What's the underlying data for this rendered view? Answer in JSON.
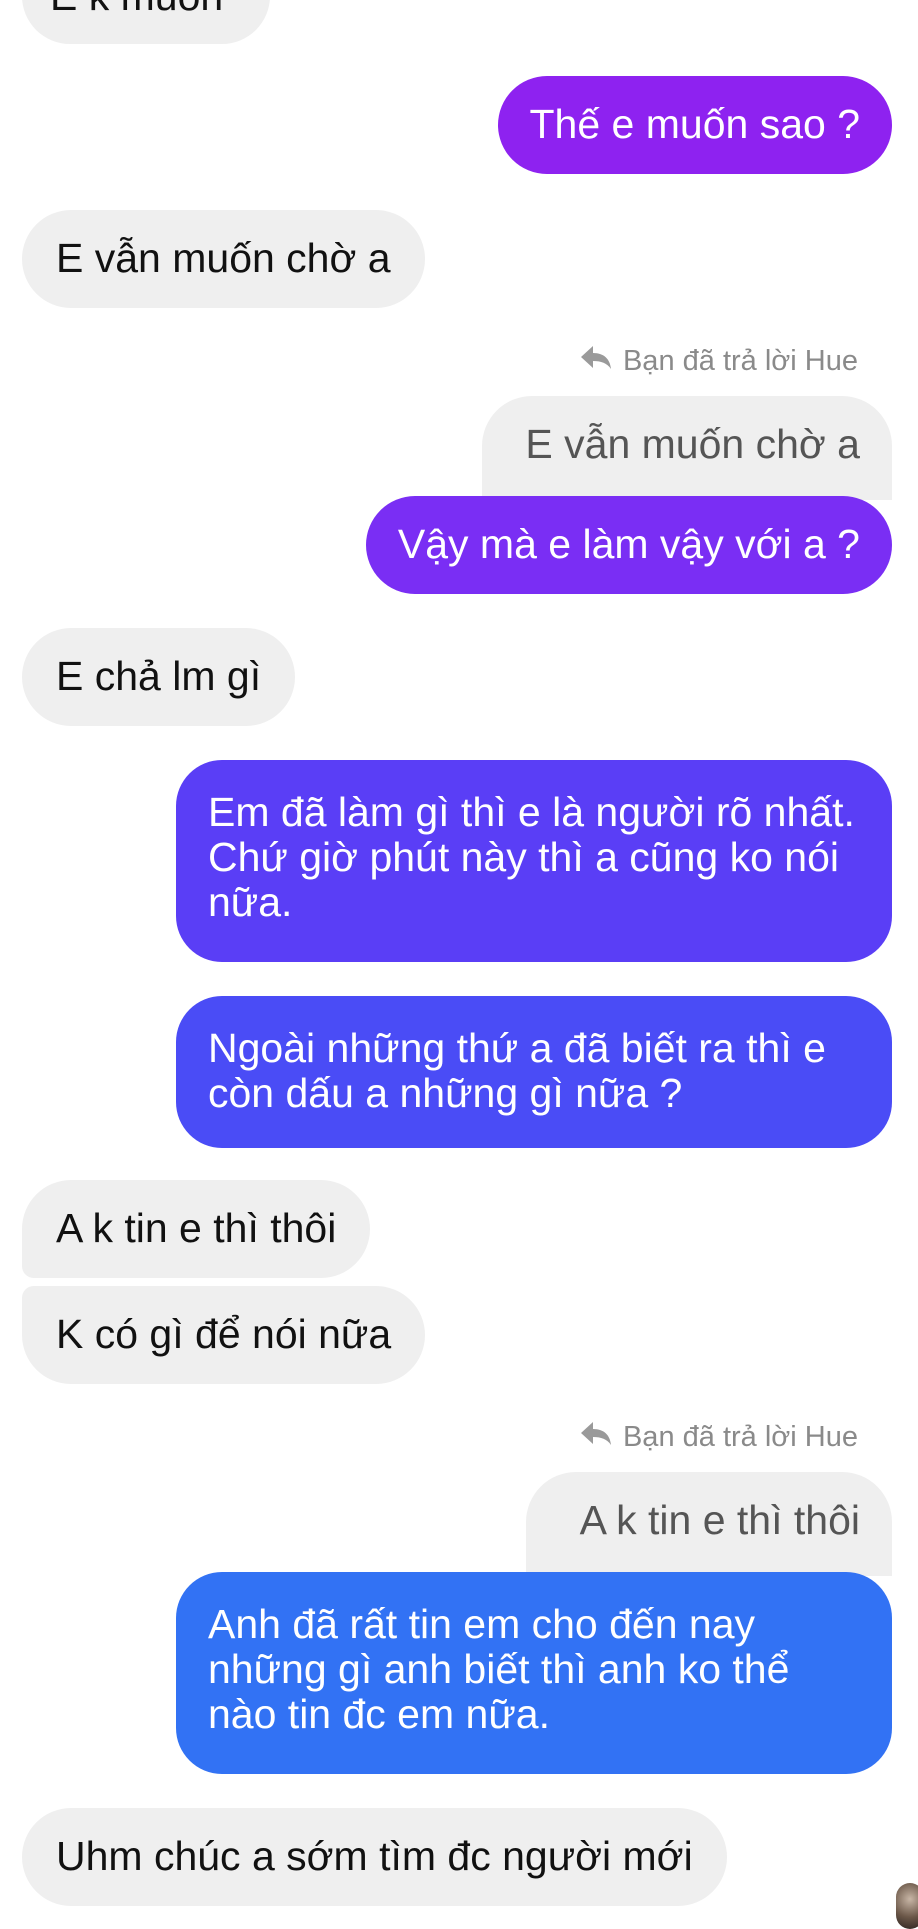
{
  "messages": {
    "m0": "E k muốn",
    "m1": "Thế e muốn sao ?",
    "m2": "E vẫn muốn chờ a",
    "reply1_note": "Bạn đã trả lời Hue",
    "reply1_quote": "E vẫn muốn chờ a",
    "m3": "Vậy mà e làm vậy với a ?",
    "m4": "E chả lm gì",
    "m5": "Em đã làm gì thì e là người rõ nhất. Chứ giờ phút này thì a cũng ko nói nữa.",
    "m6": "Ngoài những thứ a đã biết ra thì e còn dấu a những gì nữa ?",
    "m7": "A k tin e thì thôi",
    "m8": "K có gì để nói nữa",
    "reply2_note": "Bạn đã trả lời Hue",
    "reply2_quote": "A k tin e thì thôi",
    "m9": "Anh đã rất tin em cho đến nay những gì anh biết thì anh ko thể nào tin đc em nữa.",
    "m10": "Uhm chúc a sớm tìm đc người mới"
  },
  "icons": {
    "reply": "reply-arrow-icon",
    "avatar": "contact-avatar"
  },
  "colors": {
    "incoming_bubble": "#efefef",
    "outgoing_purple": "#8e22f0",
    "outgoing_violet": "#7a2ef4",
    "outgoing_indigo": "#5a3ef6",
    "outgoing_blue_indigo": "#4a4cf6",
    "outgoing_blue": "#3272f4"
  }
}
